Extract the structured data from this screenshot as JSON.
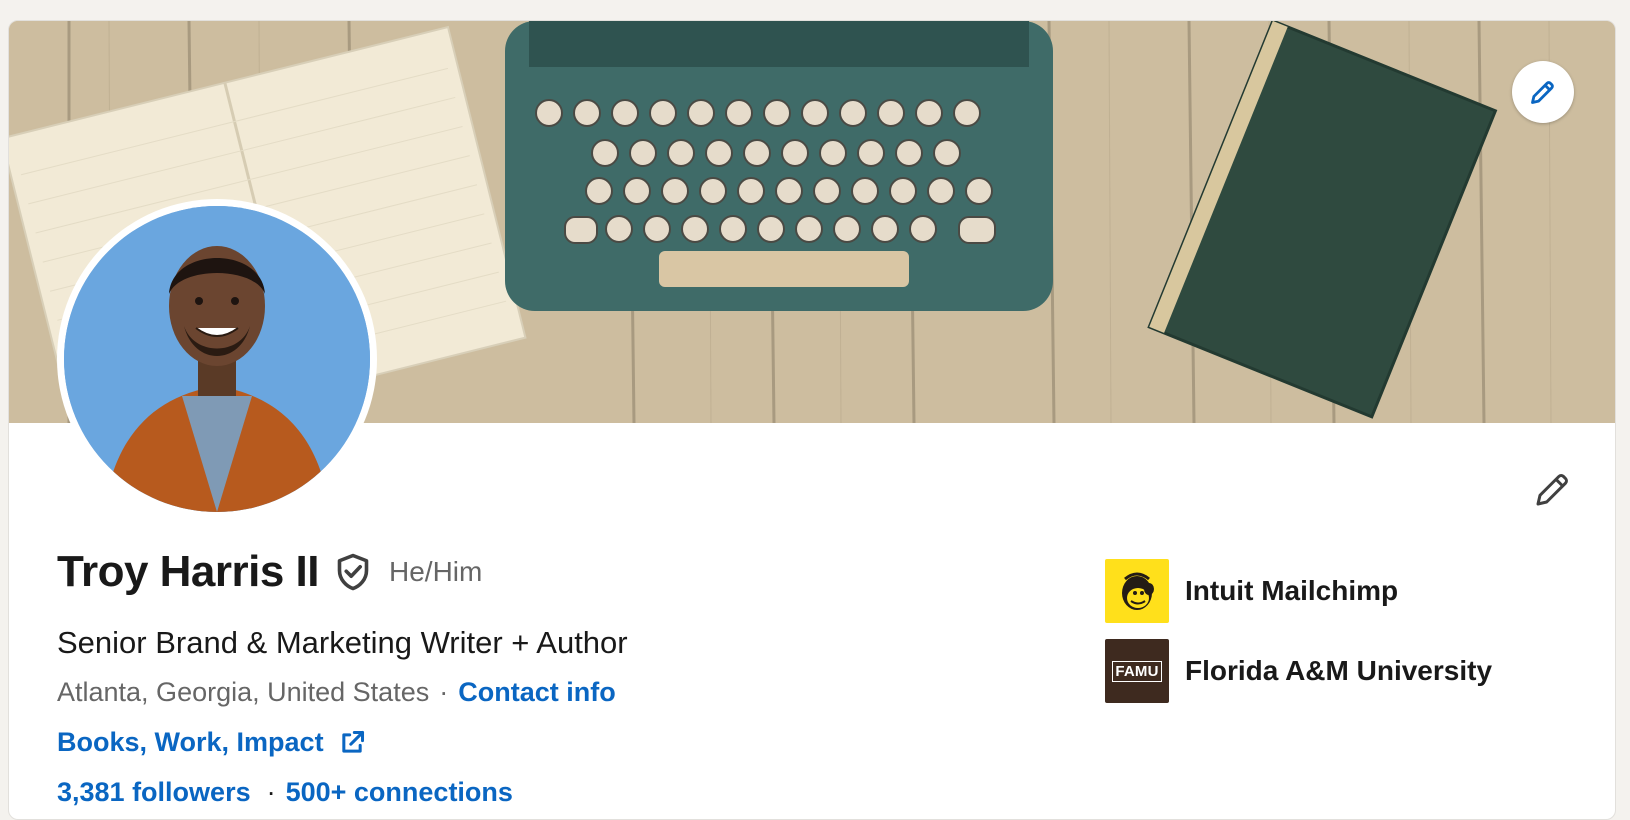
{
  "profile": {
    "name": "Troy Harris II",
    "pronouns": "He/Him",
    "headline": "Senior Brand & Marketing Writer + Author",
    "location": "Atlanta, Georgia, United States",
    "separator": "·",
    "contact_info_label": "Contact info",
    "website_label": "Books, Work, Impact",
    "followers_label": "3,381 followers",
    "connections_label": "500+ connections",
    "verified_icon": "shield-check-icon"
  },
  "banner": {
    "edit_icon": "pencil-icon",
    "image_description_icon": "typewriter-banner"
  },
  "organizations": [
    {
      "name": "Intuit Mailchimp",
      "logo_icon": "mailchimp-logo",
      "logo_color": "#ffe01b"
    },
    {
      "name": "Florida A&M University",
      "logo_icon": "famu-logo",
      "logo_text": "FAMU"
    }
  ],
  "colors": {
    "link": "#0a66c2",
    "text_primary": "#191919",
    "text_secondary": "#666666",
    "page_bg": "#f4f2ee"
  }
}
